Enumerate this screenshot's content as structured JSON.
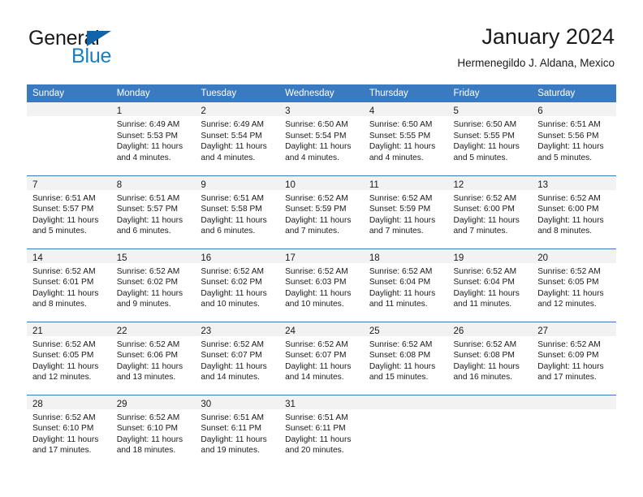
{
  "brand": {
    "name_part1": "General",
    "name_part2": "Blue"
  },
  "header": {
    "title": "January 2024",
    "subtitle": "Hermenegildo J. Aldana, Mexico"
  },
  "colors": {
    "header_blue": "#3a7ac0",
    "logo_blue": "#1b7ec1",
    "daynum_strip": "#f2f2f2"
  },
  "weekdays": [
    "Sunday",
    "Monday",
    "Tuesday",
    "Wednesday",
    "Thursday",
    "Friday",
    "Saturday"
  ],
  "weeks": [
    [
      {
        "day": "",
        "sunrise": "",
        "sunset": "",
        "daylight1": "",
        "daylight2": ""
      },
      {
        "day": "1",
        "sunrise": "Sunrise: 6:49 AM",
        "sunset": "Sunset: 5:53 PM",
        "daylight1": "Daylight: 11 hours",
        "daylight2": "and 4 minutes."
      },
      {
        "day": "2",
        "sunrise": "Sunrise: 6:49 AM",
        "sunset": "Sunset: 5:54 PM",
        "daylight1": "Daylight: 11 hours",
        "daylight2": "and 4 minutes."
      },
      {
        "day": "3",
        "sunrise": "Sunrise: 6:50 AM",
        "sunset": "Sunset: 5:54 PM",
        "daylight1": "Daylight: 11 hours",
        "daylight2": "and 4 minutes."
      },
      {
        "day": "4",
        "sunrise": "Sunrise: 6:50 AM",
        "sunset": "Sunset: 5:55 PM",
        "daylight1": "Daylight: 11 hours",
        "daylight2": "and 4 minutes."
      },
      {
        "day": "5",
        "sunrise": "Sunrise: 6:50 AM",
        "sunset": "Sunset: 5:55 PM",
        "daylight1": "Daylight: 11 hours",
        "daylight2": "and 5 minutes."
      },
      {
        "day": "6",
        "sunrise": "Sunrise: 6:51 AM",
        "sunset": "Sunset: 5:56 PM",
        "daylight1": "Daylight: 11 hours",
        "daylight2": "and 5 minutes."
      }
    ],
    [
      {
        "day": "7",
        "sunrise": "Sunrise: 6:51 AM",
        "sunset": "Sunset: 5:57 PM",
        "daylight1": "Daylight: 11 hours",
        "daylight2": "and 5 minutes."
      },
      {
        "day": "8",
        "sunrise": "Sunrise: 6:51 AM",
        "sunset": "Sunset: 5:57 PM",
        "daylight1": "Daylight: 11 hours",
        "daylight2": "and 6 minutes."
      },
      {
        "day": "9",
        "sunrise": "Sunrise: 6:51 AM",
        "sunset": "Sunset: 5:58 PM",
        "daylight1": "Daylight: 11 hours",
        "daylight2": "and 6 minutes."
      },
      {
        "day": "10",
        "sunrise": "Sunrise: 6:52 AM",
        "sunset": "Sunset: 5:59 PM",
        "daylight1": "Daylight: 11 hours",
        "daylight2": "and 7 minutes."
      },
      {
        "day": "11",
        "sunrise": "Sunrise: 6:52 AM",
        "sunset": "Sunset: 5:59 PM",
        "daylight1": "Daylight: 11 hours",
        "daylight2": "and 7 minutes."
      },
      {
        "day": "12",
        "sunrise": "Sunrise: 6:52 AM",
        "sunset": "Sunset: 6:00 PM",
        "daylight1": "Daylight: 11 hours",
        "daylight2": "and 7 minutes."
      },
      {
        "day": "13",
        "sunrise": "Sunrise: 6:52 AM",
        "sunset": "Sunset: 6:00 PM",
        "daylight1": "Daylight: 11 hours",
        "daylight2": "and 8 minutes."
      }
    ],
    [
      {
        "day": "14",
        "sunrise": "Sunrise: 6:52 AM",
        "sunset": "Sunset: 6:01 PM",
        "daylight1": "Daylight: 11 hours",
        "daylight2": "and 8 minutes."
      },
      {
        "day": "15",
        "sunrise": "Sunrise: 6:52 AM",
        "sunset": "Sunset: 6:02 PM",
        "daylight1": "Daylight: 11 hours",
        "daylight2": "and 9 minutes."
      },
      {
        "day": "16",
        "sunrise": "Sunrise: 6:52 AM",
        "sunset": "Sunset: 6:02 PM",
        "daylight1": "Daylight: 11 hours",
        "daylight2": "and 10 minutes."
      },
      {
        "day": "17",
        "sunrise": "Sunrise: 6:52 AM",
        "sunset": "Sunset: 6:03 PM",
        "daylight1": "Daylight: 11 hours",
        "daylight2": "and 10 minutes."
      },
      {
        "day": "18",
        "sunrise": "Sunrise: 6:52 AM",
        "sunset": "Sunset: 6:04 PM",
        "daylight1": "Daylight: 11 hours",
        "daylight2": "and 11 minutes."
      },
      {
        "day": "19",
        "sunrise": "Sunrise: 6:52 AM",
        "sunset": "Sunset: 6:04 PM",
        "daylight1": "Daylight: 11 hours",
        "daylight2": "and 11 minutes."
      },
      {
        "day": "20",
        "sunrise": "Sunrise: 6:52 AM",
        "sunset": "Sunset: 6:05 PM",
        "daylight1": "Daylight: 11 hours",
        "daylight2": "and 12 minutes."
      }
    ],
    [
      {
        "day": "21",
        "sunrise": "Sunrise: 6:52 AM",
        "sunset": "Sunset: 6:05 PM",
        "daylight1": "Daylight: 11 hours",
        "daylight2": "and 12 minutes."
      },
      {
        "day": "22",
        "sunrise": "Sunrise: 6:52 AM",
        "sunset": "Sunset: 6:06 PM",
        "daylight1": "Daylight: 11 hours",
        "daylight2": "and 13 minutes."
      },
      {
        "day": "23",
        "sunrise": "Sunrise: 6:52 AM",
        "sunset": "Sunset: 6:07 PM",
        "daylight1": "Daylight: 11 hours",
        "daylight2": "and 14 minutes."
      },
      {
        "day": "24",
        "sunrise": "Sunrise: 6:52 AM",
        "sunset": "Sunset: 6:07 PM",
        "daylight1": "Daylight: 11 hours",
        "daylight2": "and 14 minutes."
      },
      {
        "day": "25",
        "sunrise": "Sunrise: 6:52 AM",
        "sunset": "Sunset: 6:08 PM",
        "daylight1": "Daylight: 11 hours",
        "daylight2": "and 15 minutes."
      },
      {
        "day": "26",
        "sunrise": "Sunrise: 6:52 AM",
        "sunset": "Sunset: 6:08 PM",
        "daylight1": "Daylight: 11 hours",
        "daylight2": "and 16 minutes."
      },
      {
        "day": "27",
        "sunrise": "Sunrise: 6:52 AM",
        "sunset": "Sunset: 6:09 PM",
        "daylight1": "Daylight: 11 hours",
        "daylight2": "and 17 minutes."
      }
    ],
    [
      {
        "day": "28",
        "sunrise": "Sunrise: 6:52 AM",
        "sunset": "Sunset: 6:10 PM",
        "daylight1": "Daylight: 11 hours",
        "daylight2": "and 17 minutes."
      },
      {
        "day": "29",
        "sunrise": "Sunrise: 6:52 AM",
        "sunset": "Sunset: 6:10 PM",
        "daylight1": "Daylight: 11 hours",
        "daylight2": "and 18 minutes."
      },
      {
        "day": "30",
        "sunrise": "Sunrise: 6:51 AM",
        "sunset": "Sunset: 6:11 PM",
        "daylight1": "Daylight: 11 hours",
        "daylight2": "and 19 minutes."
      },
      {
        "day": "31",
        "sunrise": "Sunrise: 6:51 AM",
        "sunset": "Sunset: 6:11 PM",
        "daylight1": "Daylight: 11 hours",
        "daylight2": "and 20 minutes."
      },
      {
        "day": "",
        "sunrise": "",
        "sunset": "",
        "daylight1": "",
        "daylight2": ""
      },
      {
        "day": "",
        "sunrise": "",
        "sunset": "",
        "daylight1": "",
        "daylight2": ""
      },
      {
        "day": "",
        "sunrise": "",
        "sunset": "",
        "daylight1": "",
        "daylight2": ""
      }
    ]
  ]
}
